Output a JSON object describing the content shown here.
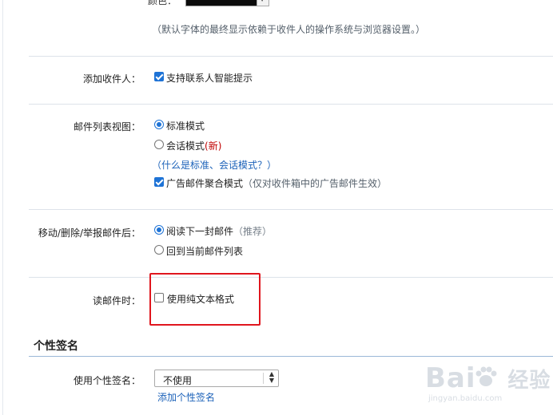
{
  "font_setting": {
    "label_partial": "颜色：",
    "note": "（默认字体的最终显示依赖于收件人的操作系统与浏览器设置。）"
  },
  "add_recipient": {
    "label": "添加收件人：",
    "option": "支持联系人智能提示",
    "checked": true
  },
  "list_view": {
    "label": "邮件列表视图：",
    "standard": "标准模式",
    "conversation": "会话模式",
    "new_badge": "(新)",
    "help_link": "（什么是标准、会话模式？）",
    "ad_aggregate": "广告邮件聚合模式",
    "ad_note": "（仅对收件箱中的广告邮件生效）"
  },
  "after_action": {
    "label": "移动/删除/举报邮件后：",
    "read_next": "阅读下一封邮件",
    "recommended": "（推荐）",
    "back_to_list": "回到当前邮件列表"
  },
  "reading": {
    "label": "读邮件时：",
    "plain_text": "使用纯文本格式",
    "checked": false
  },
  "signature": {
    "section_title": "个性签名",
    "label": "使用个性签名：",
    "selected": "不使用",
    "add_link": "添加个性签名"
  },
  "watermark": {
    "main": "Bai",
    "main2": "经验",
    "sub": "jingyan.baidu.com"
  },
  "colors": {
    "accent": "#1e73d6",
    "highlight": "#e0161e",
    "link": "#1c62b9"
  }
}
